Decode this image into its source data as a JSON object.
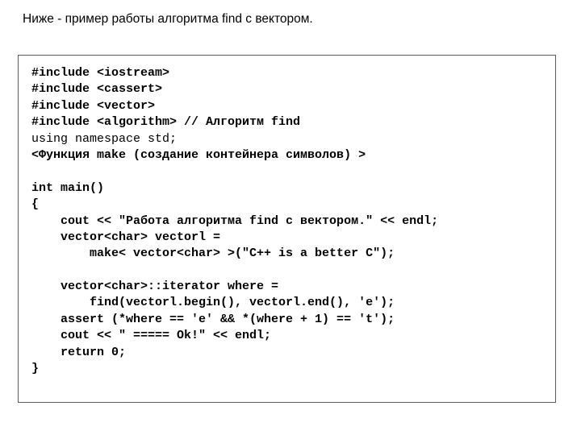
{
  "slide": {
    "caption": "Ниже - пример работы алгоритма find с вектором.",
    "frame": {
      "border_color": "#5b5b5b",
      "background_color": "#ffffff"
    },
    "code": {
      "language": "cpp",
      "text_color": "#000000",
      "lines": [
        {
          "text": "#include <iostream>",
          "weight": "bold"
        },
        {
          "text": "#include <cassert>",
          "weight": "bold"
        },
        {
          "text": "#include <vector>",
          "weight": "bold"
        },
        {
          "text": "#include <algorithm> // Алгоритм find",
          "weight": "bold"
        },
        {
          "text": "using namespace std;",
          "weight": "normal"
        },
        {
          "text": "<Функция make (создание контейнера символов) >",
          "weight": "bold"
        },
        {
          "text": "",
          "weight": "normal"
        },
        {
          "text": "int main()",
          "weight": "bold"
        },
        {
          "text": "{",
          "weight": "bold"
        },
        {
          "text": "    cout << \"Работа алгоритма find с вектором.\" << endl;",
          "weight": "bold"
        },
        {
          "text": "    vector<char> vectorl =",
          "weight": "bold"
        },
        {
          "text": "        make< vector<char> >(\"C++ is a better C\");",
          "weight": "bold"
        },
        {
          "text": "",
          "weight": "normal"
        },
        {
          "text": "    vector<char>::iterator where =",
          "weight": "bold"
        },
        {
          "text": "        find(vectorl.begin(), vectorl.end(), 'e');",
          "weight": "bold"
        },
        {
          "text": "    assert (*where == 'e' && *(where + 1) == 't');",
          "weight": "bold"
        },
        {
          "text": "    cout << \" ===== Ok!\" << endl;",
          "weight": "bold"
        },
        {
          "text": "    return 0;",
          "weight": "bold"
        },
        {
          "text": "}",
          "weight": "bold"
        }
      ]
    }
  }
}
